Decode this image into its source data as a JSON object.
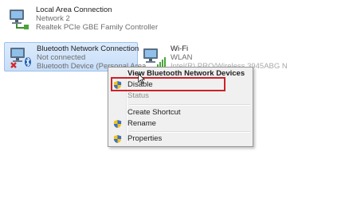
{
  "connections": [
    {
      "name": "Local Area Connection",
      "line2": "Network  2",
      "line3": "Realtek PCIe GBE Family Controller",
      "icon": "network-adapter-icon"
    },
    {
      "name": "Bluetooth Network Connection",
      "line2": "Not connected",
      "line3": "Bluetooth Device (Personal Area",
      "icon": "bluetooth-adapter-icon",
      "state": "selected"
    },
    {
      "name": "Wi-Fi",
      "line2": "WLAN",
      "line3": "Intel(R) PRO/Wireless 3945ABG N",
      "icon": "wifi-adapter-icon"
    }
  ],
  "context_menu": {
    "items": [
      {
        "label": "View Bluetooth Network Devices",
        "bold": true
      },
      {
        "label": "Disable",
        "icon": "uac-shield-icon",
        "highlighted": true
      },
      {
        "label": "Status",
        "disabled": true
      },
      {
        "label": "Create Shortcut"
      },
      {
        "label": "Rename",
        "icon": "uac-shield-icon"
      },
      {
        "label": "Properties",
        "icon": "uac-shield-icon"
      }
    ]
  },
  "colors": {
    "annotation": "#cc2128",
    "selection": "#cde4fb",
    "not_connected_x": "#d22b2b",
    "bluetooth": "#1b5fb5"
  }
}
